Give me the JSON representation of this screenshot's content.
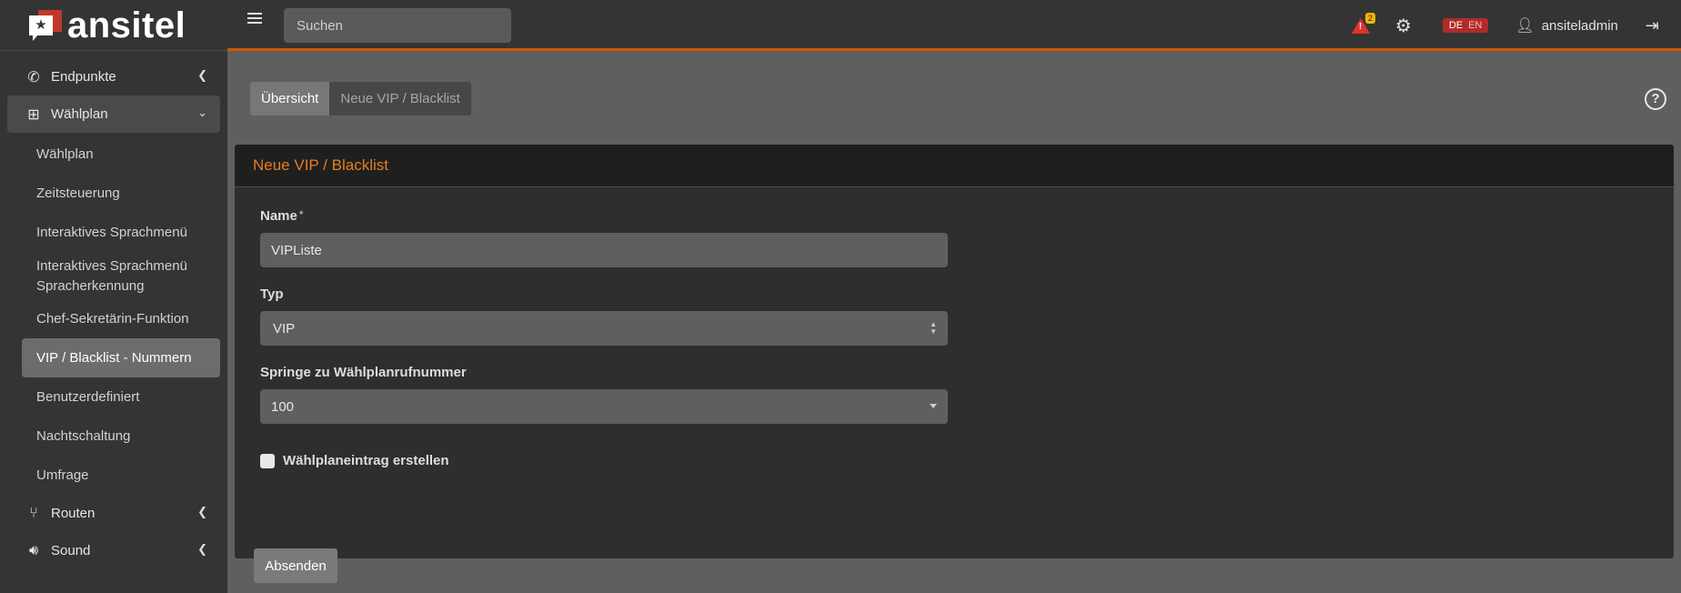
{
  "brand": {
    "name": "ansitel"
  },
  "topbar": {
    "search_placeholder": "Suchen",
    "alert_count": "2",
    "lang_de": "DE",
    "lang_en": "EN",
    "username": "ansiteladmin"
  },
  "sidebar": {
    "items": [
      {
        "label": "Endpunkte",
        "icon": "phone-icon"
      },
      {
        "label": "Wählplan",
        "icon": "sitemap-icon",
        "expanded": true
      },
      {
        "label": "Routen",
        "icon": "route-icon"
      },
      {
        "label": "Sound",
        "icon": "sound-icon"
      }
    ],
    "sub_items": [
      {
        "label": "Wählplan"
      },
      {
        "label": "Zeitsteuerung"
      },
      {
        "label": "Interaktives Sprachmenü"
      },
      {
        "label": "Interaktives Sprachmenü Spracherkennung"
      },
      {
        "label": "Chef-Sekretärin-Funktion"
      },
      {
        "label": "VIP / Blacklist - Nummern",
        "active": true
      },
      {
        "label": "Benutzerdefiniert"
      },
      {
        "label": "Nachtschaltung"
      },
      {
        "label": "Umfrage"
      }
    ]
  },
  "tabs": [
    {
      "label": "Übersicht",
      "active": true
    },
    {
      "label": "Neue VIP / Blacklist",
      "active": false
    }
  ],
  "card": {
    "title": "Neue VIP / Blacklist",
    "fields": {
      "name_label": "Name",
      "required_marker": "*",
      "name_value": "VIPListe",
      "typ_label": "Typ",
      "typ_value": "VIP",
      "jump_label": "Springe zu Wählplanrufnummer",
      "jump_value": "100",
      "checkbox_label": "Wählplaneintrag erstellen",
      "checkbox_checked": false
    },
    "submit_label": "Absenden"
  },
  "colors": {
    "accent": "#e67e22",
    "topbar_border": "#d35400",
    "lang_bg": "#b32a2a",
    "alert": "#e03131"
  }
}
